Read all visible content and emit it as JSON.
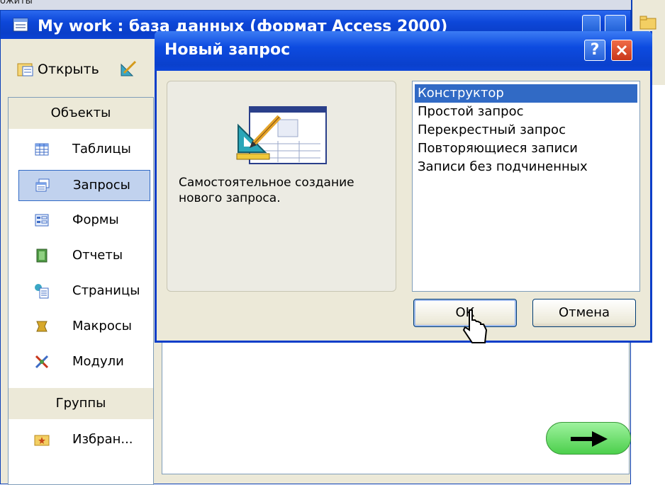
{
  "background": {
    "top_text": "ожиты"
  },
  "main_window": {
    "title": "My work : база данных (формат Access 2000)",
    "toolbar": {
      "open_label": "Открыть"
    },
    "object_bar": {
      "objects_header": "Объекты",
      "items": [
        {
          "label": "Таблицы",
          "icon": "table-icon",
          "selected": false
        },
        {
          "label": "Запросы",
          "icon": "query-icon",
          "selected": true
        },
        {
          "label": "Формы",
          "icon": "form-icon",
          "selected": false
        },
        {
          "label": "Отчеты",
          "icon": "report-icon",
          "selected": false
        },
        {
          "label": "Страницы",
          "icon": "page-icon",
          "selected": false
        },
        {
          "label": "Макросы",
          "icon": "macro-icon",
          "selected": false
        },
        {
          "label": "Модули",
          "icon": "module-icon",
          "selected": false
        }
      ],
      "groups_header": "Группы",
      "groups": [
        {
          "label": "Избран...",
          "icon": "favorites-folder-icon"
        }
      ]
    }
  },
  "dialog": {
    "title": "Новый запрос",
    "help_label": "?",
    "description": "Самостоятельное создание нового запроса.",
    "list": [
      {
        "label": "Конструктор",
        "selected": true
      },
      {
        "label": "Простой запрос",
        "selected": false
      },
      {
        "label": "Перекрестный запрос",
        "selected": false
      },
      {
        "label": "Повторяющиеся записи",
        "selected": false
      },
      {
        "label": "Записи без подчиненных",
        "selected": false
      }
    ],
    "ok_label": "ОК",
    "cancel_label": "Отмена"
  },
  "colors": {
    "titlebar": "#0a3ec9",
    "selection": "#316ac5",
    "next_button": "#4ccf4c"
  }
}
